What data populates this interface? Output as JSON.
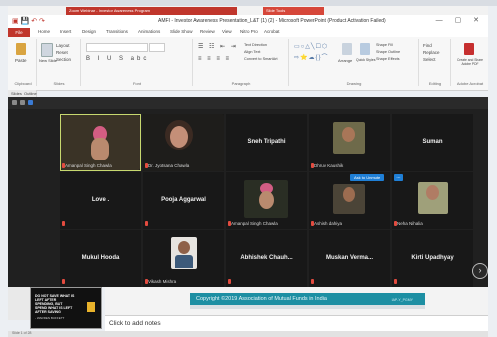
{
  "browser": {
    "tab1": "Zoom Webinar - Investor Awareness Program",
    "tab2": "Slide Tools"
  },
  "window": {
    "title": "AMFI - Investor Awareness Presentation_L&T (1) (2) - Microsoft PowerPoint (Product Activation Failed)",
    "controls": "— ▢ ✕"
  },
  "ribbon": {
    "tabs": [
      "File",
      "Home",
      "Insert",
      "Design",
      "Transitions",
      "Animations",
      "Slide Show",
      "Review",
      "View",
      "Nitro Pro",
      "Acrobat"
    ],
    "groups": {
      "clipboard": "Clipboard",
      "slides": "Slides",
      "font": "Font",
      "paragraph": "Paragraph",
      "drawing": "Drawing",
      "editing": "Editing",
      "adobe": "Adobe Acrobat"
    },
    "items": {
      "paste": "Paste",
      "new_slide": "New Slide",
      "layout": "Layout",
      "reset": "Reset",
      "section": "Section",
      "text_direction": "Text Direction",
      "align_text": "Align Text",
      "convert_smartart": "Convert to SmartArt",
      "arrange": "Arrange",
      "quick_styles": "Quick Styles",
      "shape_fill": "Shape Fill",
      "shape_outline": "Shape Outline",
      "shape_effects": "Shape Effects",
      "find": "Find",
      "replace": "Replace",
      "select": "Select",
      "create_share": "Create and Share Adobe PDF"
    }
  },
  "panel": {
    "slides_tab": "Slides",
    "outline_tab": "Outline"
  },
  "meeting": {
    "participants": [
      {
        "name": "Amanpal Singh Chawla",
        "video": true
      },
      {
        "name": "Dr. Jyotsana Chawla",
        "video": true
      },
      {
        "name": "Sneh Tripathi",
        "video": false
      },
      {
        "name": "Dhruv Kaushik",
        "video": true
      },
      {
        "name": "Suman",
        "video": false
      },
      {
        "name": "Love .",
        "video": false
      },
      {
        "name": "Pooja Aggarwal",
        "video": false
      },
      {
        "name": "Amanpal Singh Chawla",
        "video": true
      },
      {
        "name": "Ashish dahiya",
        "video": true
      },
      {
        "name": "Neha Nihalia",
        "video": true
      },
      {
        "name": "Mukul Hooda",
        "video": false
      },
      {
        "name": "Vikash Mishra",
        "video": true
      },
      {
        "name": "Abhishek Chauh...",
        "video": false
      },
      {
        "name": "Muskan Verma...",
        "video": false
      },
      {
        "name": "Kirti Upadhyay",
        "video": false
      }
    ],
    "ask_to_unmute": "Ask to Unmute",
    "more": "...",
    "next": "›"
  },
  "slide": {
    "thumb_title": "DO NOT SAVE WHAT IS LEFT AFTER SPENDING, BUT SPEND WHAT IS LEFT AFTER SAVING",
    "thumb_author": "- WARREN BUFFETT",
    "copyright": "Copyright ©2019 Association of Mutual Funds in India",
    "slide_code": "IAP-Y_PGMY"
  },
  "notes": {
    "placeholder": "Click to add notes"
  },
  "status": {
    "text": "Slide 1 of 28"
  }
}
